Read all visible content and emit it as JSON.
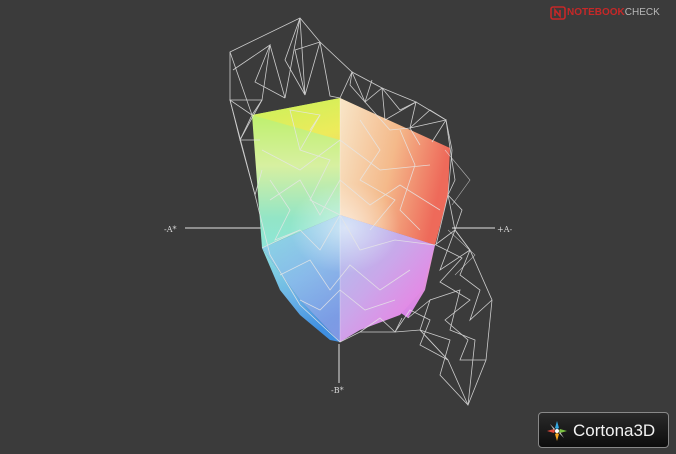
{
  "axes": {
    "neg_a": "-A*",
    "pos_a": "+A-",
    "neg_b": "-B*"
  },
  "watermark": {
    "brand": "NOTEBOOKCHECK",
    "brand_strong": "NOTEBOOK",
    "brand_light": "CHECK"
  },
  "badge": {
    "text": "Cortona3D"
  },
  "colors": {
    "background": "#3b3b3b",
    "wireframe": "#e6e6e6",
    "axis": "#e0e0e0",
    "watermark_red": "#c62828"
  }
}
